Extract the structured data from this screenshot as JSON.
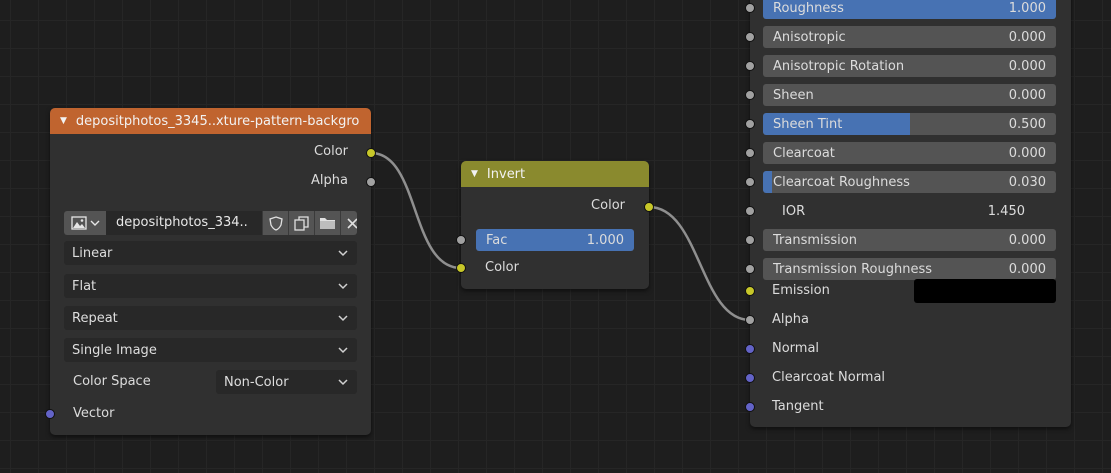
{
  "image_node": {
    "title": "depositphotos_3345..xture-pattern-backgro",
    "outputs": [
      "Color",
      "Alpha"
    ],
    "image_name": "depositphotos_334..",
    "interpolation": "Linear",
    "projection": "Flat",
    "extension": "Repeat",
    "source": "Single Image",
    "color_space_label": "Color Space",
    "color_space": "Non-Color",
    "input_vector": "Vector",
    "header_color": "#c0642f"
  },
  "invert_node": {
    "title": "Invert",
    "output": "Color",
    "fac_label": "Fac",
    "fac_value": "1.000",
    "fac_fraction": 1.0,
    "input_color": "Color",
    "header_color": "#8a8a2e"
  },
  "bsdf_node": {
    "fields": [
      {
        "label": "Roughness",
        "value": "1.000",
        "fill": 1.0
      },
      {
        "label": "Anisotropic",
        "value": "0.000",
        "fill": 0.0
      },
      {
        "label": "Anisotropic Rotation",
        "value": "0.000",
        "fill": 0.0
      },
      {
        "label": "Sheen",
        "value": "0.000",
        "fill": 0.0
      },
      {
        "label": "Sheen Tint",
        "value": "0.500",
        "fill": 0.5
      },
      {
        "label": "Clearcoat",
        "value": "0.000",
        "fill": 0.0
      },
      {
        "label": "Clearcoat Roughness",
        "value": "0.030",
        "fill": 0.03
      },
      {
        "label": "IOR",
        "value": "1.450",
        "fill": 0.0
      },
      {
        "label": "Transmission",
        "value": "0.000",
        "fill": 0.0
      },
      {
        "label": "Transmission Roughness",
        "value": "0.000",
        "fill": 0.0
      }
    ],
    "emission_label": "Emission",
    "emission_color": "#000000",
    "alpha_label": "Alpha",
    "vector_inputs": [
      "Normal",
      "Clearcoat Normal",
      "Tangent"
    ]
  },
  "colors": {
    "socket_yellow": "#c7c729",
    "socket_gray": "#a1a1a1",
    "socket_blue": "#6363c7",
    "accent": "#4772b3",
    "wire": "#a0a0a0"
  },
  "icons": [
    "image-type-icon",
    "chevron-down-icon",
    "fake-user-shield-icon",
    "duplicate-icon",
    "open-folder-icon",
    "close-icon"
  ]
}
